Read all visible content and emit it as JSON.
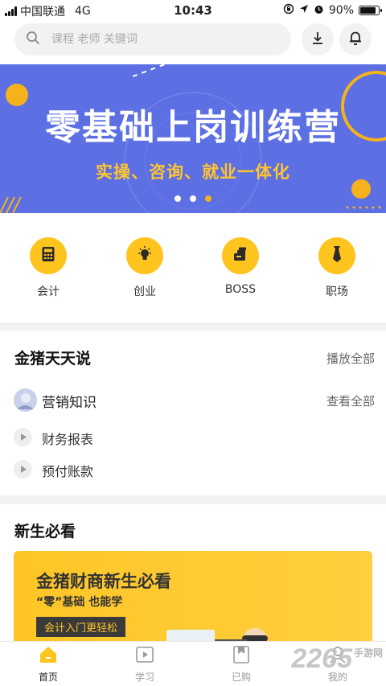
{
  "status_bar": {
    "carrier": "中国联通",
    "network": "4G",
    "time": "10:43",
    "battery": "90%",
    "battery_level": 0.9
  },
  "search": {
    "placeholder": "课程 老师 关键词"
  },
  "banner": {
    "title": "零基础上岗训练营",
    "subtitle": "实操、咨询、就业一体化",
    "pages": 3,
    "active_page": 2
  },
  "categories": [
    {
      "label": "会计",
      "icon": "calculator-icon"
    },
    {
      "label": "创业",
      "icon": "lightbulb-icon"
    },
    {
      "label": "BOSS",
      "icon": "boss-icon"
    },
    {
      "label": "职场",
      "icon": "necktie-icon"
    }
  ],
  "daily_talk": {
    "title": "金猪天天说",
    "action": "播放全部",
    "featured": {
      "label": "营销知识",
      "action": "查看全部"
    },
    "items": [
      {
        "label": "财务报表"
      },
      {
        "label": "预付账款"
      }
    ]
  },
  "newcomer": {
    "title": "新生必看",
    "promo": {
      "title": "金猪财商新生必看",
      "subtitle": "“零”基础 也能学",
      "tag": "会计入门更轻松"
    }
  },
  "tabbar": [
    {
      "label": "首页",
      "icon": "home-icon",
      "active": true
    },
    {
      "label": "学习",
      "icon": "play-square-icon",
      "active": false
    },
    {
      "label": "已购",
      "icon": "bookmark-icon",
      "active": false
    },
    {
      "label": "我的",
      "icon": "person-icon",
      "active": false
    }
  ],
  "watermark": {
    "text": "2265",
    "site": "手游网"
  },
  "colors": {
    "accent": "#ffc41e",
    "banner_bg": "#5c6fe3",
    "banner_subtitle": "#ffc530"
  }
}
